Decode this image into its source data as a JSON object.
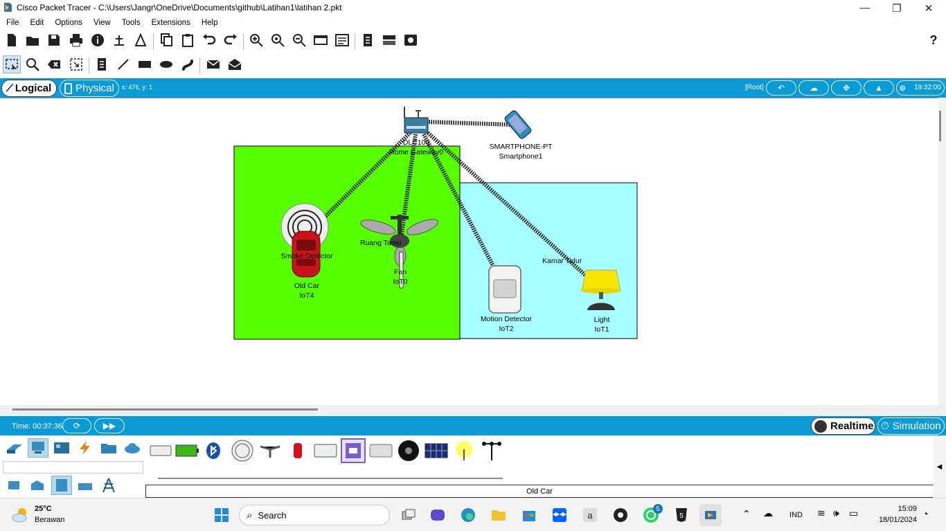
{
  "window": {
    "title": "Cisco Packet Tracer - C:\\Users\\Jangr\\OneDrive\\Documents\\github\\Latihan1\\latihan 2.pkt",
    "minimize": "—",
    "maximize": "❐",
    "close": "✕"
  },
  "menu": [
    "File",
    "Edit",
    "Options",
    "View",
    "Tools",
    "Extensions",
    "Help"
  ],
  "toolbar": {
    "help": "?"
  },
  "viewbar": {
    "logical_label": "Logical",
    "physical_label": "Physical",
    "coords": "x: 476, y: 1",
    "root_label": "[Root]",
    "clock": "19:32:00"
  },
  "workspace": {
    "areas": [
      {
        "label": "Ruang Tamu",
        "color": "#57ff00"
      },
      {
        "label": "Kamar Tidur",
        "color": "#a8ffff"
      }
    ],
    "devices": {
      "gateway": {
        "model": "DLC100",
        "name": "Home Gateway0"
      },
      "smartphone": {
        "model": "SMARTPHONE-PT",
        "name": "Smartphone1"
      },
      "smoke": {
        "model": "Smoke Detector",
        "name": ""
      },
      "oldcar": {
        "model": "Old Car",
        "name": "IoT4"
      },
      "fan": {
        "model": "Fan",
        "name": "IoT0"
      },
      "motion": {
        "model": "Motion Detector",
        "name": "IoT2"
      },
      "light": {
        "model": "Light",
        "name": "IoT1"
      }
    }
  },
  "bottombar": {
    "time": "Time: 00:37:36",
    "realtime": "Realtime",
    "simulation": "Simulation"
  },
  "device_panel": {
    "status": "Old Car"
  },
  "taskbar": {
    "weather_temp": "25°C",
    "weather_desc": "Berawan",
    "search": "Search",
    "whatsapp_badge": "5",
    "lang": "IND",
    "time": "15:09",
    "date": "18/01/2024"
  }
}
